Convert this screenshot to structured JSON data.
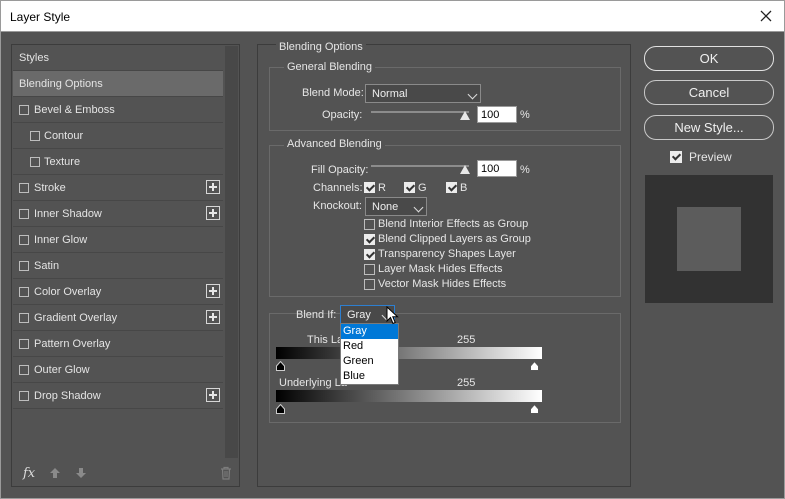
{
  "window": {
    "title": "Layer Style"
  },
  "sidebar": {
    "items": [
      {
        "label": "Styles",
        "checkbox": false,
        "plus": false,
        "indent": 0
      },
      {
        "label": "Blending Options",
        "checkbox": false,
        "plus": false,
        "indent": 0,
        "selected": true
      },
      {
        "label": "Bevel & Emboss",
        "checkbox": true,
        "plus": false,
        "indent": 0
      },
      {
        "label": "Contour",
        "checkbox": true,
        "plus": false,
        "indent": 1
      },
      {
        "label": "Texture",
        "checkbox": true,
        "plus": false,
        "indent": 1
      },
      {
        "label": "Stroke",
        "checkbox": true,
        "plus": true,
        "indent": 0
      },
      {
        "label": "Inner Shadow",
        "checkbox": true,
        "plus": true,
        "indent": 0
      },
      {
        "label": "Inner Glow",
        "checkbox": true,
        "plus": false,
        "indent": 0
      },
      {
        "label": "Satin",
        "checkbox": true,
        "plus": false,
        "indent": 0
      },
      {
        "label": "Color Overlay",
        "checkbox": true,
        "plus": true,
        "indent": 0
      },
      {
        "label": "Gradient Overlay",
        "checkbox": true,
        "plus": true,
        "indent": 0
      },
      {
        "label": "Pattern Overlay",
        "checkbox": true,
        "plus": false,
        "indent": 0
      },
      {
        "label": "Outer Glow",
        "checkbox": true,
        "plus": false,
        "indent": 0
      },
      {
        "label": "Drop Shadow",
        "checkbox": true,
        "plus": true,
        "indent": 0
      }
    ],
    "fx_label": "fx"
  },
  "blending": {
    "section_title": "Blending Options",
    "general": {
      "title": "General Blending",
      "blend_mode_label": "Blend Mode:",
      "blend_mode_value": "Normal",
      "opacity_label": "Opacity:",
      "opacity_value": "100",
      "opacity_unit": "%"
    },
    "advanced": {
      "title": "Advanced Blending",
      "fill_opacity_label": "Fill Opacity:",
      "fill_opacity_value": "100",
      "fill_opacity_unit": "%",
      "channels_label": "Channels:",
      "channels": [
        {
          "label": "R",
          "checked": true
        },
        {
          "label": "G",
          "checked": true
        },
        {
          "label": "B",
          "checked": true
        }
      ],
      "knockout_label": "Knockout:",
      "knockout_value": "None",
      "options": [
        {
          "label": "Blend Interior Effects as Group",
          "checked": false
        },
        {
          "label": "Blend Clipped Layers as Group",
          "checked": true
        },
        {
          "label": "Transparency Shapes Layer",
          "checked": true
        },
        {
          "label": "Layer Mask Hides Effects",
          "checked": false
        },
        {
          "label": "Vector Mask Hides Effects",
          "checked": false
        }
      ]
    },
    "blend_if": {
      "label": "Blend If:",
      "value": "Gray",
      "dropdown_options": [
        "Gray",
        "Red",
        "Green",
        "Blue"
      ],
      "highlighted_option": "Gray",
      "this_layer_label": "This La",
      "this_layer_max": "255",
      "underlying_label": "Underlying La",
      "underlying_max": "255"
    }
  },
  "buttons": {
    "ok": "OK",
    "cancel": "Cancel",
    "new_style": "New Style..."
  },
  "preview": {
    "label": "Preview",
    "checked": true
  },
  "colors": {
    "dialog_bg": "#535353",
    "highlight": "#0078d7",
    "selected_row": "#6a6a6a"
  }
}
